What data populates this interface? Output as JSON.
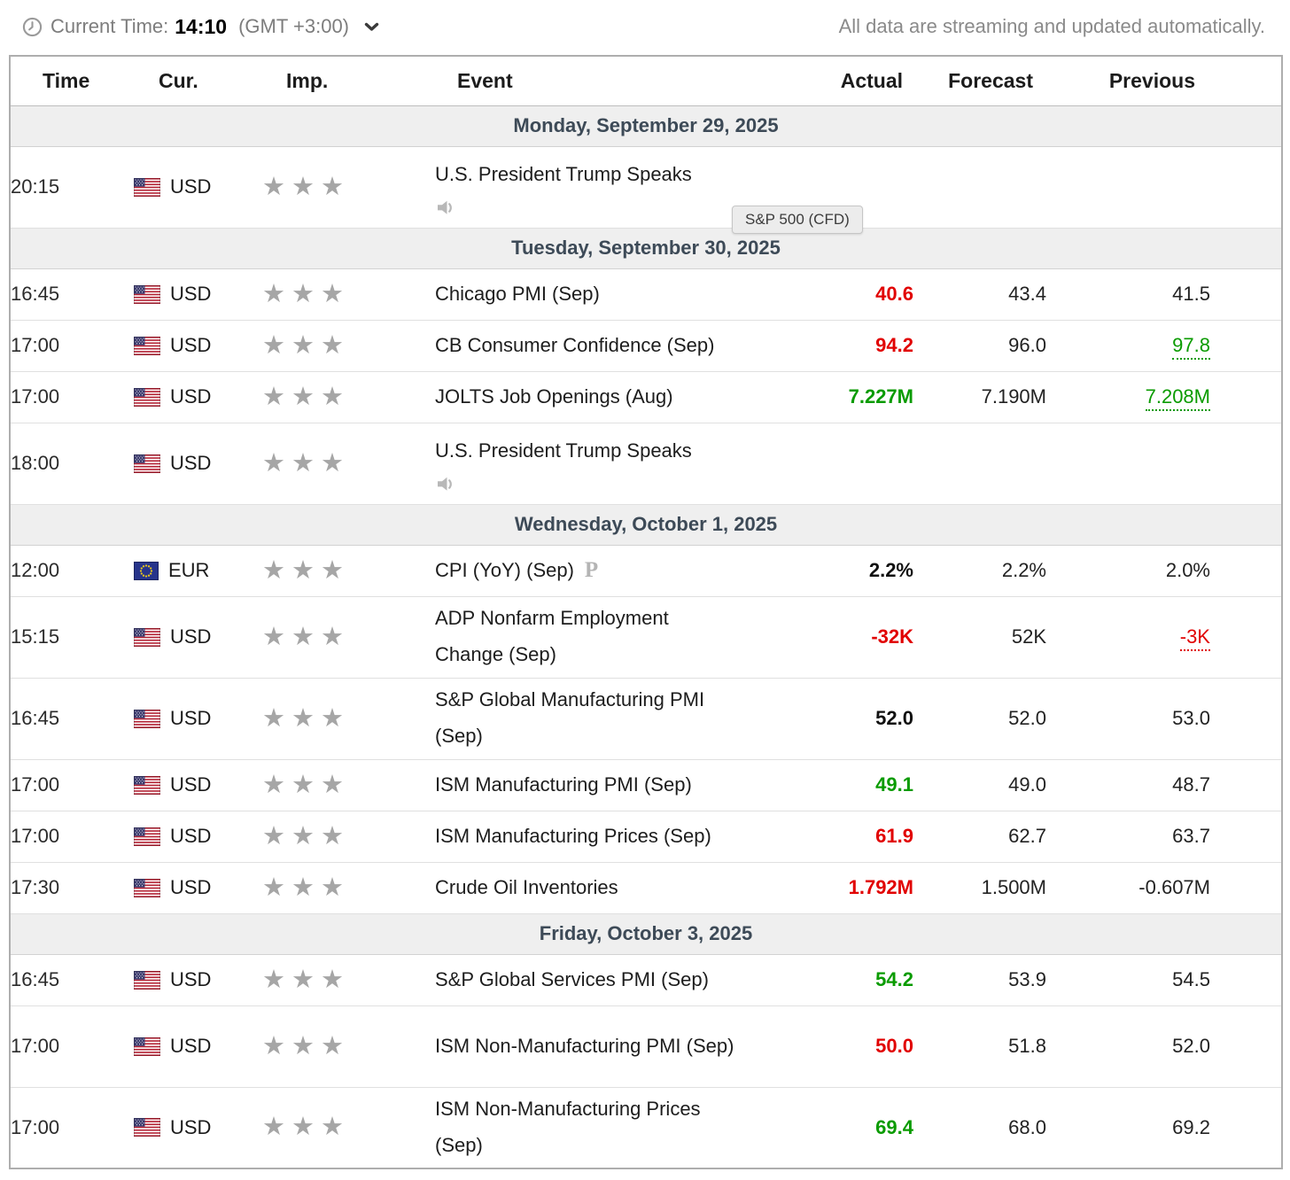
{
  "toolbar": {
    "current_time_label": "Current Time:",
    "current_time_value": "14:10",
    "timezone": "(GMT +3:00)",
    "streaming_note": "All data are streaming and updated automatically."
  },
  "tooltip": {
    "text": "S&P 500 (CFD)"
  },
  "colors": {
    "positive": "#0a9b00",
    "negative": "#e10000",
    "day_header_text": "#3d4a57"
  },
  "table": {
    "headers": [
      "Time",
      "Cur.",
      "Imp.",
      "Event",
      "Actual",
      "Forecast",
      "Previous"
    ],
    "sections": [
      {
        "date": "Monday, September 29, 2025",
        "rows": [
          {
            "time": "20:15",
            "flag": "us",
            "currency": "USD",
            "importance": 3,
            "event": "U.S. President Trump Speaks",
            "speech": true,
            "tall": true,
            "actual": {
              "text": "",
              "tone": ""
            },
            "forecast": "",
            "previous": {
              "text": "",
              "tone": ""
            }
          }
        ]
      },
      {
        "date": "Tuesday, September 30, 2025",
        "rows": [
          {
            "time": "16:45",
            "flag": "us",
            "currency": "USD",
            "importance": 3,
            "event": "Chicago PMI (Sep)",
            "actual": {
              "text": "40.6",
              "tone": "neg"
            },
            "forecast": "43.4",
            "previous": {
              "text": "41.5",
              "tone": "plain"
            }
          },
          {
            "time": "17:00",
            "flag": "us",
            "currency": "USD",
            "importance": 3,
            "event": "CB Consumer Confidence (Sep)",
            "actual": {
              "text": "94.2",
              "tone": "neg"
            },
            "forecast": "96.0",
            "previous": {
              "text": "97.8",
              "tone": "pos-rev"
            }
          },
          {
            "time": "17:00",
            "flag": "us",
            "currency": "USD",
            "importance": 3,
            "event": "JOLTS Job Openings (Aug)",
            "actual": {
              "text": "7.227M",
              "tone": "pos"
            },
            "forecast": "7.190M",
            "previous": {
              "text": "7.208M",
              "tone": "pos-rev"
            }
          },
          {
            "time": "18:00",
            "flag": "us",
            "currency": "USD",
            "importance": 3,
            "event": "U.S. President Trump Speaks",
            "speech": true,
            "tall": true,
            "actual": {
              "text": "",
              "tone": ""
            },
            "forecast": "",
            "previous": {
              "text": "",
              "tone": ""
            }
          }
        ]
      },
      {
        "date": "Wednesday, October 1, 2025",
        "rows": [
          {
            "time": "12:00",
            "flag": "eu",
            "currency": "EUR",
            "importance": 3,
            "event": "CPI (YoY) (Sep)",
            "preliminary": true,
            "actual": {
              "text": "2.2%",
              "tone": "bold"
            },
            "forecast": "2.2%",
            "previous": {
              "text": "2.0%",
              "tone": "plain"
            }
          },
          {
            "time": "15:15",
            "flag": "us",
            "currency": "USD",
            "importance": 3,
            "event": "ADP Nonfarm Employment Change (Sep)",
            "tall": true,
            "actual": {
              "text": "-32K",
              "tone": "neg"
            },
            "forecast": "52K",
            "previous": {
              "text": "-3K",
              "tone": "neg-rev"
            }
          },
          {
            "time": "16:45",
            "flag": "us",
            "currency": "USD",
            "importance": 3,
            "event": "S&P Global Manufacturing PMI (Sep)",
            "tall": true,
            "actual": {
              "text": "52.0",
              "tone": "bold"
            },
            "forecast": "52.0",
            "previous": {
              "text": "53.0",
              "tone": "plain"
            }
          },
          {
            "time": "17:00",
            "flag": "us",
            "currency": "USD",
            "importance": 3,
            "event": "ISM Manufacturing PMI (Sep)",
            "actual": {
              "text": "49.1",
              "tone": "pos"
            },
            "forecast": "49.0",
            "previous": {
              "text": "48.7",
              "tone": "plain"
            }
          },
          {
            "time": "17:00",
            "flag": "us",
            "currency": "USD",
            "importance": 3,
            "event": "ISM Manufacturing Prices (Sep)",
            "actual": {
              "text": "61.9",
              "tone": "neg"
            },
            "forecast": "62.7",
            "previous": {
              "text": "63.7",
              "tone": "plain"
            }
          },
          {
            "time": "17:30",
            "flag": "us",
            "currency": "USD",
            "importance": 3,
            "event": "Crude Oil Inventories",
            "actual": {
              "text": "1.792M",
              "tone": "neg"
            },
            "forecast": "1.500M",
            "previous": {
              "text": "-0.607M",
              "tone": "plain"
            }
          }
        ]
      },
      {
        "date": "Friday, October 3, 2025",
        "rows": [
          {
            "time": "16:45",
            "flag": "us",
            "currency": "USD",
            "importance": 3,
            "event": "S&P Global Services PMI (Sep)",
            "actual": {
              "text": "54.2",
              "tone": "pos"
            },
            "forecast": "53.9",
            "previous": {
              "text": "54.5",
              "tone": "plain"
            }
          },
          {
            "time": "17:00",
            "flag": "us",
            "currency": "USD",
            "importance": 3,
            "event": "ISM Non-Manufacturing PMI (Sep)",
            "tall": true,
            "actual": {
              "text": "50.0",
              "tone": "neg"
            },
            "forecast": "51.8",
            "previous": {
              "text": "52.0",
              "tone": "plain"
            }
          },
          {
            "time": "17:00",
            "flag": "us",
            "currency": "USD",
            "importance": 3,
            "event": "ISM Non-Manufacturing Prices (Sep)",
            "tall": true,
            "actual": {
              "text": "69.4",
              "tone": "pos"
            },
            "forecast": "68.0",
            "previous": {
              "text": "69.2",
              "tone": "plain"
            }
          }
        ]
      }
    ]
  }
}
